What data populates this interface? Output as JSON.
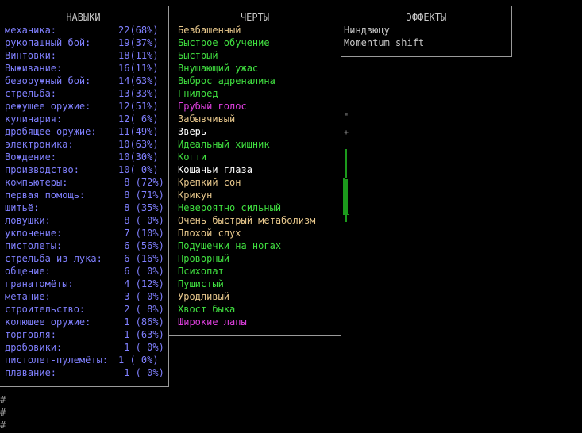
{
  "skills": {
    "title": "НАВЫКИ",
    "items": [
      {
        "name": "механика:",
        "value": "22(68%)"
      },
      {
        "name": "рукопашный бой:",
        "value": "19(37%)"
      },
      {
        "name": "Винтовки:",
        "value": "18(11%)"
      },
      {
        "name": "Выживание:",
        "value": "16(11%)"
      },
      {
        "name": "безоружный бой:",
        "value": "14(63%)"
      },
      {
        "name": "стрельба:",
        "value": "13(33%)"
      },
      {
        "name": "режущее оружие:",
        "value": "12(51%)"
      },
      {
        "name": "кулинария:",
        "value": "12( 6%)"
      },
      {
        "name": "дробящее оружие:",
        "value": "11(49%)"
      },
      {
        "name": "электроника:",
        "value": "10(63%)"
      },
      {
        "name": "Вождение:",
        "value": "10(30%)"
      },
      {
        "name": "производство:",
        "value": "10( 0%)"
      },
      {
        "name": "компьютеры:",
        "value": " 8 (72%)"
      },
      {
        "name": "первая помощь:",
        "value": " 8 (71%)"
      },
      {
        "name": "шитьё:",
        "value": " 8 (35%)"
      },
      {
        "name": "ловушки:",
        "value": " 8 ( 0%)"
      },
      {
        "name": "уклонение:",
        "value": " 7 (10%)"
      },
      {
        "name": "пистолеты:",
        "value": " 6 (56%)"
      },
      {
        "name": "стрельба из лука:",
        "value": " 6 (16%)"
      },
      {
        "name": "общение:",
        "value": " 6 ( 0%)"
      },
      {
        "name": "гранатомёты:",
        "value": " 4 (12%)"
      },
      {
        "name": "метание:",
        "value": " 3 ( 0%)"
      },
      {
        "name": "строительство:",
        "value": " 2 ( 8%)"
      },
      {
        "name": "колющее оружие:",
        "value": " 1 (86%)"
      },
      {
        "name": "торговля:",
        "value": " 1 (63%)"
      },
      {
        "name": "дробовики:",
        "value": " 1 ( 0%)"
      },
      {
        "name": "пистолет-пулемёты:",
        "value": "1 ( 0%)"
      },
      {
        "name": "плавание:",
        "value": " 1 ( 0%)"
      }
    ]
  },
  "traits": {
    "title": "ЧЕРТЫ",
    "items": [
      {
        "name": "Безбашенный",
        "color": "#e8c88c"
      },
      {
        "name": "Быстрое обучение",
        "color": "#40e040"
      },
      {
        "name": "Быстрый",
        "color": "#40e040"
      },
      {
        "name": "Внушающий ужас",
        "color": "#40e040"
      },
      {
        "name": "Выброс адреналина",
        "color": "#40e040"
      },
      {
        "name": "Гнилоед",
        "color": "#40e040"
      },
      {
        "name": "Грубый голос",
        "color": "#e040e0"
      },
      {
        "name": "Забывчивый",
        "color": "#e8c88c"
      },
      {
        "name": "Зверь",
        "color": "#ffffff"
      },
      {
        "name": "Идеальный хищник",
        "color": "#40e040"
      },
      {
        "name": "Когти",
        "color": "#40e040"
      },
      {
        "name": "Кошачьи глаза",
        "color": "#ffffff"
      },
      {
        "name": "Крепкий сон",
        "color": "#e8c88c"
      },
      {
        "name": "Крикун",
        "color": "#e8c88c"
      },
      {
        "name": "Невероятно сильный",
        "color": "#40e040"
      },
      {
        "name": "Очень быстрый метаболизм",
        "color": "#e8c88c"
      },
      {
        "name": "Плохой слух",
        "color": "#e8c88c"
      },
      {
        "name": "Подушечки на ногах",
        "color": "#40e040"
      },
      {
        "name": "Проворный",
        "color": "#40e040"
      },
      {
        "name": "Психопат",
        "color": "#40e040"
      },
      {
        "name": "Пушистый",
        "color": "#40e040"
      },
      {
        "name": "Уродливый",
        "color": "#e8c88c"
      },
      {
        "name": "Хвост быка",
        "color": "#40e040"
      },
      {
        "name": "Широкие лапы",
        "color": "#e040e0"
      }
    ]
  },
  "effects": {
    "title": "ЭФФЕКТЫ",
    "items": [
      "Ниндзюцу",
      "Momentum shift"
    ]
  },
  "decor": {
    "hash1": "#",
    "hash2": "#",
    "hash3": "#",
    "mark1": "\"",
    "mark2": "+"
  }
}
